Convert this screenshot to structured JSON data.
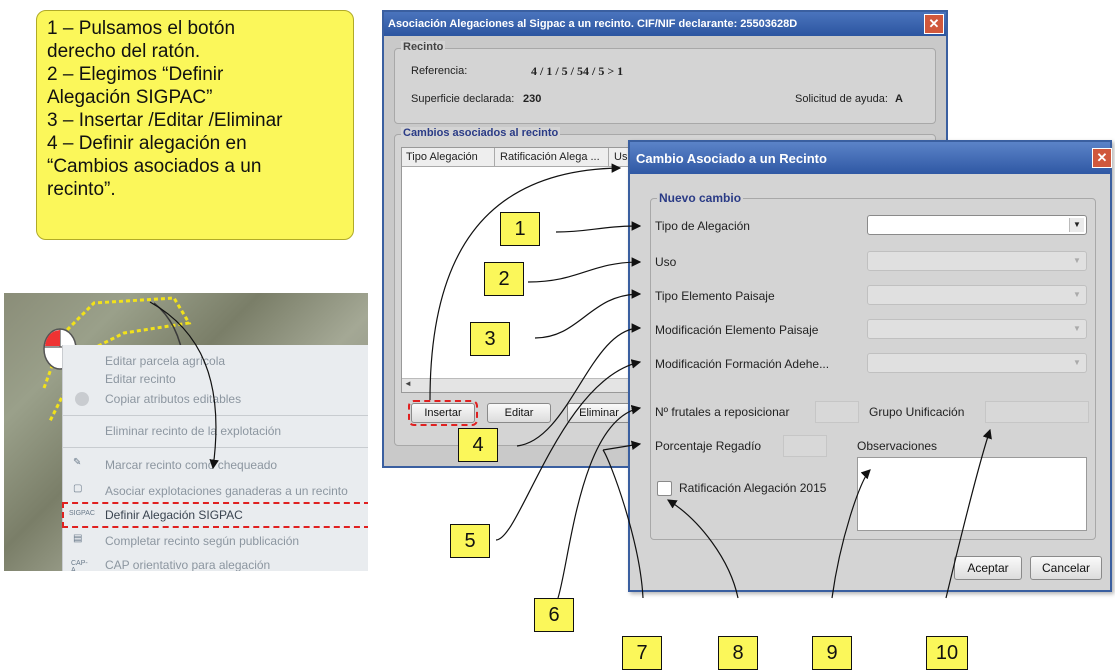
{
  "note": {
    "lines": [
      "1 – Pulsamos el botón",
      "derecho del ratón.",
      "2 – Elegimos “Definir",
      "Alegación SIGPAC”",
      "3 – Insertar /Editar /Eliminar",
      "4 – Definir alegación en",
      "“Cambios asociados a un",
      "recinto”."
    ]
  },
  "context_menu": {
    "items": [
      {
        "label": "Editar parcela agrícola",
        "icon": ""
      },
      {
        "label": "Editar recinto",
        "icon": ""
      },
      {
        "label": "Copiar atributos editables",
        "icon": "circle-icon"
      },
      {
        "label": "Eliminar recinto de la explotación",
        "icon": ""
      },
      {
        "label": "Marcar recinto como chequeado",
        "icon": "feather-icon"
      },
      {
        "label": "Asociar explotaciones ganaderas a un recinto",
        "icon": "frame-icon"
      },
      {
        "label": "Definir Alegación SIGPAC",
        "icon": "SIGPAC"
      },
      {
        "label": "Completar recinto según publicación",
        "icon": "document-icon"
      },
      {
        "label": "CAP orientativo para alegación",
        "icon": "CAP-A"
      }
    ]
  },
  "dialog_main": {
    "title": "Asociación Alegaciones al Sigpac a un recinto. CIF/NIF declarante: 25503628D",
    "close": "✕",
    "recinto_legend": "Recinto",
    "referencia_label": "Referencia:",
    "referencia_value": "4 / 1 / 5 / 54 / 5 > 1",
    "superficie_label": "Superficie declarada:",
    "superficie_value": "230",
    "solicitud_label": "Solicitud de ayuda:",
    "solicitud_value": "A",
    "cambios_legend": "Cambios asociados al recinto",
    "columns": [
      "Tipo Alegación",
      "Ratificación Alega ...",
      "Uso"
    ],
    "buttons": {
      "insertar": "Insertar",
      "editar": "Editar",
      "eliminar": "Eliminar"
    }
  },
  "dialog_cambio": {
    "title": "Cambio Asociado a un Recinto",
    "close": "✕",
    "legend": "Nuevo cambio",
    "tipo_alegacion": "Tipo de Alegación",
    "uso": "Uso",
    "tipo_elemento": "Tipo Elemento Paisaje",
    "mod_elemento": "Modificación Elemento Paisaje",
    "mod_formacion": "Modificación Formación Adehe...",
    "frutales": "Nº frutales a reposicionar",
    "grupo": "Grupo Unificación",
    "regadio": "Porcentaje Regadío",
    "observaciones": "Observaciones",
    "ratificacion": "Ratificación Alegación 2015",
    "aceptar": "Aceptar",
    "cancelar": "Cancelar"
  },
  "callouts": [
    "1",
    "2",
    "3",
    "4",
    "5",
    "6",
    "7",
    "8",
    "9",
    "10"
  ],
  "colors": {
    "note": "#fbf75a",
    "title_bar": "#2f58a4",
    "legend": "#2a3b86",
    "highlight": "#e02020"
  }
}
